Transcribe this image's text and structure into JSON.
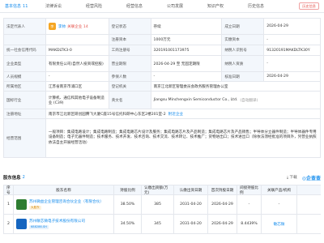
{
  "tabs": [
    {
      "label": "基本信息",
      "count": "11"
    },
    {
      "label": "法律诉讼",
      "count": ""
    },
    {
      "label": "经营风险",
      "count": ""
    },
    {
      "label": "经营信息",
      "count": ""
    },
    {
      "label": "公司发展",
      "count": ""
    },
    {
      "label": "知识产权",
      "count": ""
    },
    {
      "label": "历史信息",
      "count": ""
    }
  ],
  "header_badge": "历史信息",
  "info": {
    "legal_rep_label": "法定代表人",
    "legal_rep_avatar": "李",
    "legal_rep_name": "李帅",
    "legal_rep_tag": "关联企业 14",
    "status_label": "登记状态",
    "status_value": "存续",
    "founded_label": "成立日期",
    "founded_value": "2026-04-29",
    "capital_label": "注册资本",
    "capital_value": "1000万元",
    "paid_label": "实缴资本",
    "paid_value": "-",
    "credit_label": "统一社会信用代码",
    "credit_value": "MAKDLTK3-0",
    "reg_no_label": "工商注册号",
    "reg_no_value": "320191001173975",
    "tax_label": "纳税人识别号",
    "tax_value": "91320191MAKDLTK30Y",
    "type_label": "企业类型",
    "type_value": "有限责任公司(自然人投资或控股)",
    "term_label": "营业期限",
    "term_value": "2026-04-29 至 无固定期限",
    "taxpayer_label": "纳税人资质",
    "taxpayer_value": "-",
    "staff_label": "人员规模",
    "staff_value": "-",
    "insured_label": "参保人数",
    "insured_value": "-",
    "approval_label": "核准日期",
    "approval_value": "2026-04-29",
    "region_label": "所属地区",
    "region_value": "江苏省南京市浦口区",
    "authority_label": "登记机关",
    "authority_value": "南京江北新区管理委员会政务服务管理办公室",
    "industry_label": "国标行业",
    "industry_value": "计算机、通信和其他电子设备制造业 (C39)",
    "english_label": "英文名",
    "english_value": "Jiangsu Minchengxin Semiconductor Co., Ltd.",
    "english_note": "(自动翻译)",
    "address_label": "注册地址",
    "address_value": "南京市江北新区研创园腾飞大厦C座15号信托科研中心东区2楼201室-2",
    "address_link": "附近企业",
    "scope_label": "经营范围",
    "scope_value": "一般项目：集成电路设计；集成电路制造；集成电路芯片设计及服务；集成电路芯片及产品制造；集成电路芯片及产品销售；半导体分立器件制造；半导体器件专用设备制造；电子元器件制造；技术服务、技术开发、技术咨询、技术交流、技术转让、技术推广；货物进出口；技术进出口（除依法须经批准的项目外，凭营业执照依法自主开展经营活动）"
  },
  "shareholders": {
    "title": "股东信息",
    "count": "2",
    "download": "下载",
    "brand": "企查查",
    "headers": [
      "序号",
      "股东名称",
      "持股比例",
      "认缴出资额(万元)",
      "认缴出资日期",
      "首次持股日期",
      "间接持股比例",
      "关联产品/机构"
    ],
    "rows": [
      {
        "idx": "1",
        "name": "苏州微益企业管理咨询合伙企业（有限合伙）",
        "chip": "大股东",
        "chip_type": "y",
        "ratio": "38.50%",
        "amount": "385",
        "date": "2031-04-20",
        "first": "2026-04-29",
        "indirect": "-",
        "related": "-"
      },
      {
        "idx": "2",
        "name": "苏州敏芯微电子技术股份有限公司",
        "chip": "688286.SH",
        "chip_type": "b",
        "ratio": "34.50%",
        "amount": "345",
        "date": "2031-04-20",
        "first": "2026-04-29",
        "indirect": "8.4439%",
        "related": "敏芯微"
      }
    ]
  }
}
